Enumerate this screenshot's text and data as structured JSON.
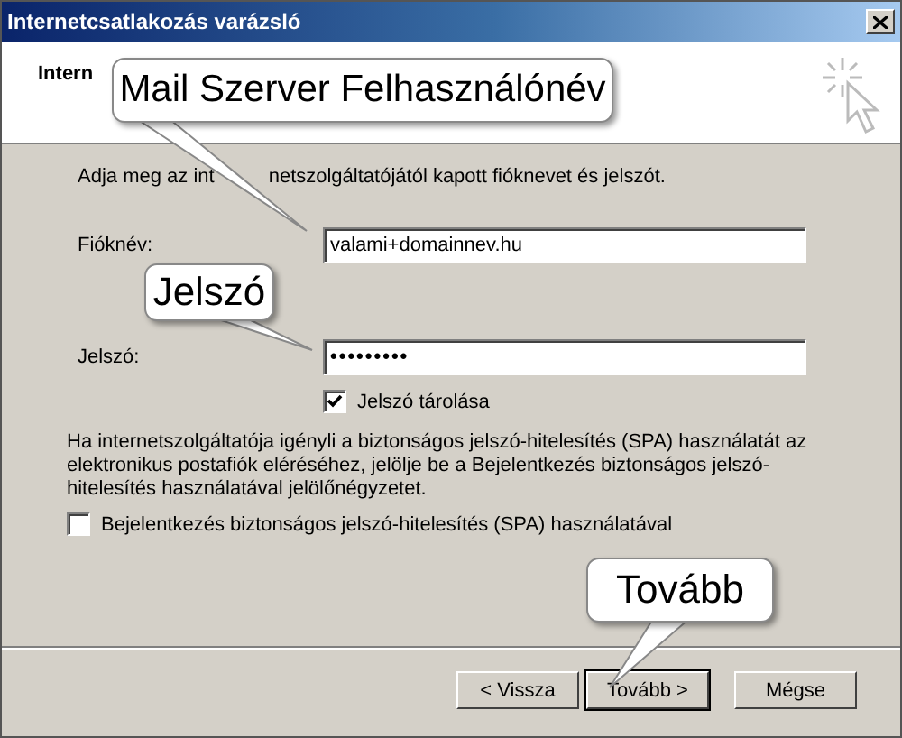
{
  "window": {
    "title": "Internetcsatlakozás varázsló"
  },
  "header": {
    "title": "Intern"
  },
  "intro": [
    "Adja meg az int",
    "netszolgáltatójától kapott fióknevet és jelszót."
  ],
  "fields": [
    {
      "label": "Fióknév:",
      "value": "valami+domainnev.hu",
      "kind": "text"
    },
    {
      "label": "Jelszó:",
      "value": "•••••••••",
      "kind": "password"
    }
  ],
  "remember": {
    "label": "Jelszó tárolása",
    "checked": true
  },
  "spa_note": "Ha internetszolgáltatója igényli a biztonságos jelszó-hitelesítés (SPA) használatát az elektronikus postafiók eléréséhez, jelölje be a Bejelentkezés biztonságos jelszó-hitelesítés használatával jelölőnégyzetet.",
  "spa": {
    "label": "Bejelentkezés biztonságos jelszó-hitelesítés (SPA) használatával",
    "checked": false
  },
  "buttons": [
    {
      "label": "< Vissza",
      "default": false
    },
    {
      "label": "Tovább >",
      "default": true
    },
    {
      "label": "Mégse",
      "default": false
    }
  ],
  "callouts": [
    {
      "text": "Mail Szerver Felhasználónév"
    },
    {
      "text": "Jelszó"
    },
    {
      "text": "Tovább"
    }
  ]
}
